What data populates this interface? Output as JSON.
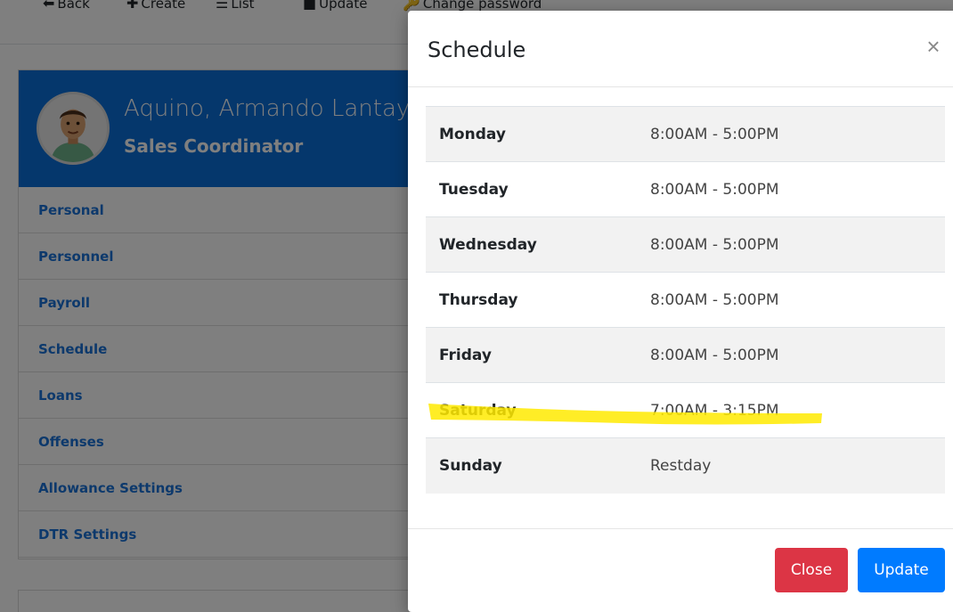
{
  "toolbar": {
    "items": [
      {
        "icon": "arrow-left-icon",
        "glyph": "⬅",
        "label": "Back"
      },
      {
        "icon": "plus-icon",
        "glyph": "✚",
        "label": "Create"
      },
      {
        "icon": "list-icon",
        "glyph": "☰",
        "label": "List"
      },
      {
        "icon": "square-icon",
        "glyph": "■",
        "label": "Update"
      },
      {
        "icon": "key-icon",
        "glyph": "🔑",
        "label": "Change password"
      }
    ]
  },
  "profile": {
    "name": "Aquino, Armando Lantay",
    "role": "Sales Coordinator"
  },
  "sidebar": {
    "items": [
      {
        "label": "Personal"
      },
      {
        "label": "Personnel"
      },
      {
        "label": "Payroll"
      },
      {
        "label": "Schedule"
      },
      {
        "label": "Loans"
      },
      {
        "label": "Offenses"
      },
      {
        "label": "Allowance Settings"
      },
      {
        "label": "DTR Settings"
      }
    ]
  },
  "modal": {
    "title": "Schedule",
    "close_glyph": "×",
    "rows": [
      {
        "day": "Monday",
        "time": "8:00AM - 5:00PM"
      },
      {
        "day": "Tuesday",
        "time": "8:00AM - 5:00PM"
      },
      {
        "day": "Wednesday",
        "time": "8:00AM - 5:00PM"
      },
      {
        "day": "Thursday",
        "time": "8:00AM - 5:00PM"
      },
      {
        "day": "Friday",
        "time": "8:00AM - 5:00PM"
      },
      {
        "day": "Saturday",
        "time": "7:00AM - 3:15PM"
      },
      {
        "day": "Sunday",
        "time": "Restday"
      }
    ],
    "close_label": "Close",
    "update_label": "Update"
  },
  "colors": {
    "primary": "#007bff",
    "danger": "#dc3545",
    "profile_header": "#0b6fd8",
    "highlighter": "#ffea00"
  }
}
